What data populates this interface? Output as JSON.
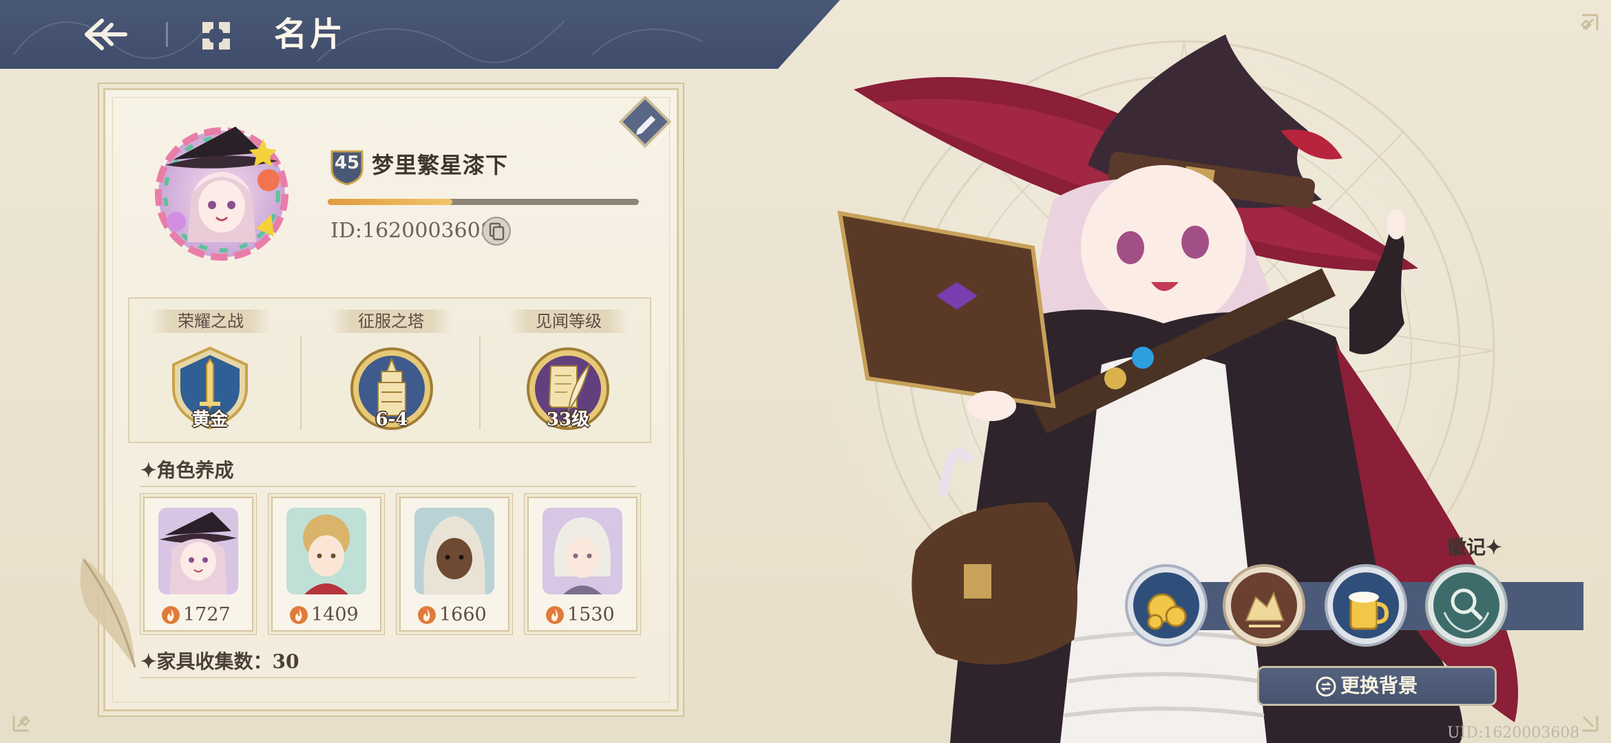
{
  "header": {
    "title": "名片"
  },
  "profile": {
    "level": "45",
    "name": "梦里繁星漆下",
    "xp_progress": 0.4,
    "id_text": "ID:1620003608"
  },
  "stats": [
    {
      "label": "荣耀之战",
      "value": "黄金",
      "icon": "sword-shield-icon"
    },
    {
      "label": "征服之塔",
      "value": "6-4",
      "icon": "tower-icon"
    },
    {
      "label": "见闻等级",
      "value": "33级",
      "icon": "scroll-quill-icon"
    }
  ],
  "character_section": {
    "title": "✦角色养成",
    "characters": [
      {
        "power": "1727",
        "portrait": "witch-girl-portrait"
      },
      {
        "power": "1409",
        "portrait": "blonde-lady-portrait"
      },
      {
        "power": "1660",
        "portrait": "hooded-figure-portrait"
      },
      {
        "power": "1530",
        "portrait": "white-hair-man-portrait"
      }
    ]
  },
  "furniture": {
    "label": "✦家具收集数：30"
  },
  "badges": {
    "title": "徽记✦",
    "items": [
      "golden-coins-badge",
      "treasure-badge",
      "ale-mug-badge",
      "magnifier-laurel-badge"
    ]
  },
  "actions": {
    "change_background": "更换背景"
  },
  "footer": {
    "uid": "UID:1620003608"
  },
  "colors": {
    "header_bg": "#4a5877",
    "panel_bg": "#f7f2e6",
    "accent_gold": "#e09b3c",
    "text_dark": "#3f3630"
  }
}
